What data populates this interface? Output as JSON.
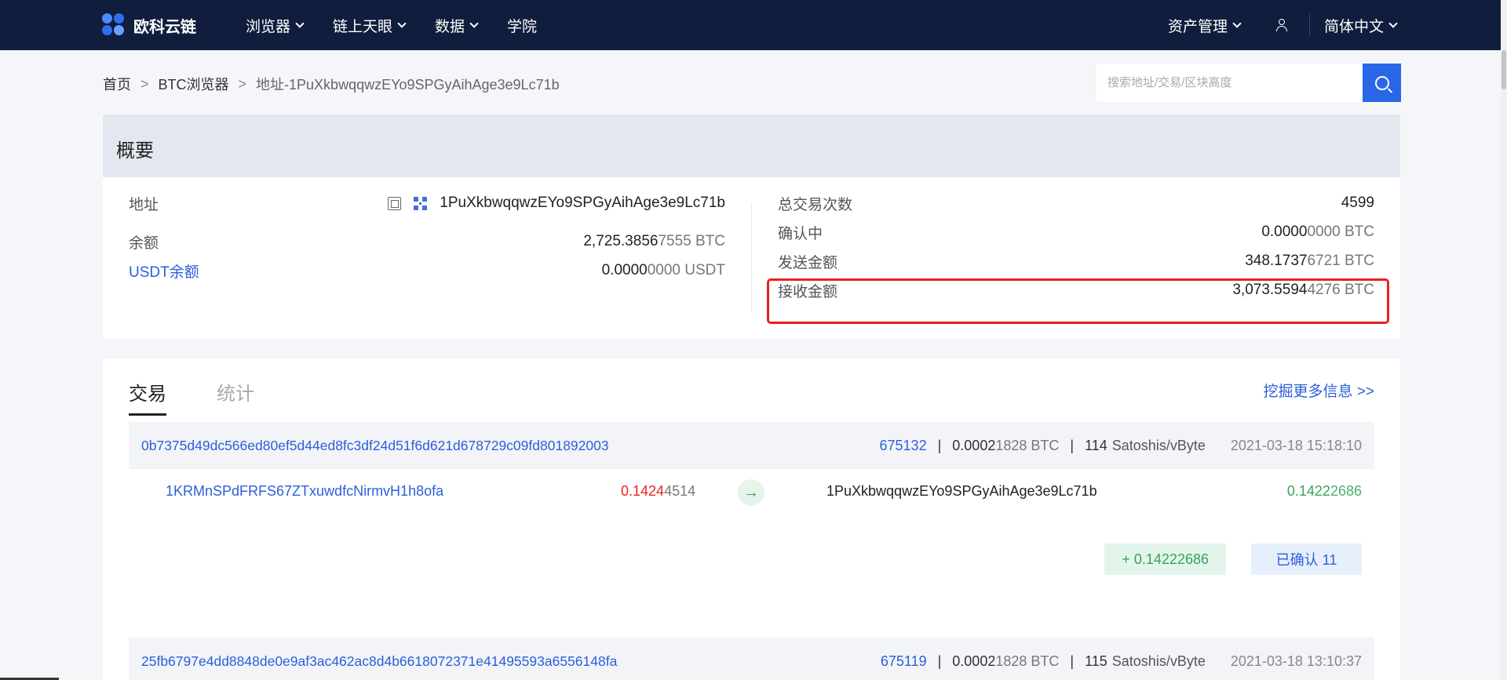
{
  "header": {
    "logo_text": "欧科云链",
    "nav": [
      "浏览器",
      "链上天眼",
      "数据",
      "学院"
    ],
    "asset_menu": "资产管理",
    "language": "简体中文"
  },
  "breadcrumb": {
    "home": "首页",
    "explorer": "BTC浏览器",
    "current": "地址-1PuXkbwqqwzEYo9SPGyAihAge3e9Lc71b"
  },
  "search": {
    "placeholder": "搜索地址/交易/区块高度"
  },
  "overview": {
    "title": "概要",
    "address_label": "地址",
    "address_value": "1PuXkbwqqwzEYo9SPGyAihAge3e9Lc71b",
    "balance_label": "余额",
    "balance_strong": "2,725.3856",
    "balance_faded": "7555 BTC",
    "usdt_label": "USDT余额",
    "usdt_strong": "0.0000",
    "usdt_faded": "0000 USDT",
    "tx_count_label": "总交易次数",
    "tx_count_value": "4599",
    "pending_label": "确认中",
    "pending_strong": "0.0000",
    "pending_faded": "0000 BTC",
    "sent_label": "发送金额",
    "sent_strong": "348.1737",
    "sent_faded": "6721 BTC",
    "received_label": "接收金额",
    "received_strong": "3,073.5594",
    "received_faded": "4276 BTC"
  },
  "transactions": {
    "tabs": [
      "交易",
      "统计"
    ],
    "more_link": "挖掘更多信息 >>",
    "items": [
      {
        "hash": "0b7375d49dc566ed80ef5d44ed8fc3df24d51f6d621d678729c09fd801892003",
        "block": "675132",
        "fee_strong": "0.0002",
        "fee_faded": "1828 BTC",
        "rate": "114",
        "rate_unit": "Satoshis/vByte",
        "time": "2021-03-18 15:18:10",
        "input_address": "1KRMnSPdFRFS67ZTxuwdfcNirmvH1h8ofa",
        "input_amount_red": "0.1424",
        "input_amount_faded": "4514",
        "output_address": "1PuXkbwqqwzEYo9SPGyAihAge3e9Lc71b",
        "output_amount_strong": "0.1422",
        "output_amount_faded": "2686",
        "net_change": "+ 0.14222686",
        "confirmations": "已确认 11"
      },
      {
        "hash": "25fb6797e4dd8848de0e9af3ac462ac8d4b6618072371e41495593a6556148fa",
        "block": "675119",
        "fee_strong": "0.0002",
        "fee_faded": "1828 BTC",
        "rate": "115",
        "rate_unit": "Satoshis/vByte",
        "time": "2021-03-18 13:10:37"
      }
    ]
  }
}
